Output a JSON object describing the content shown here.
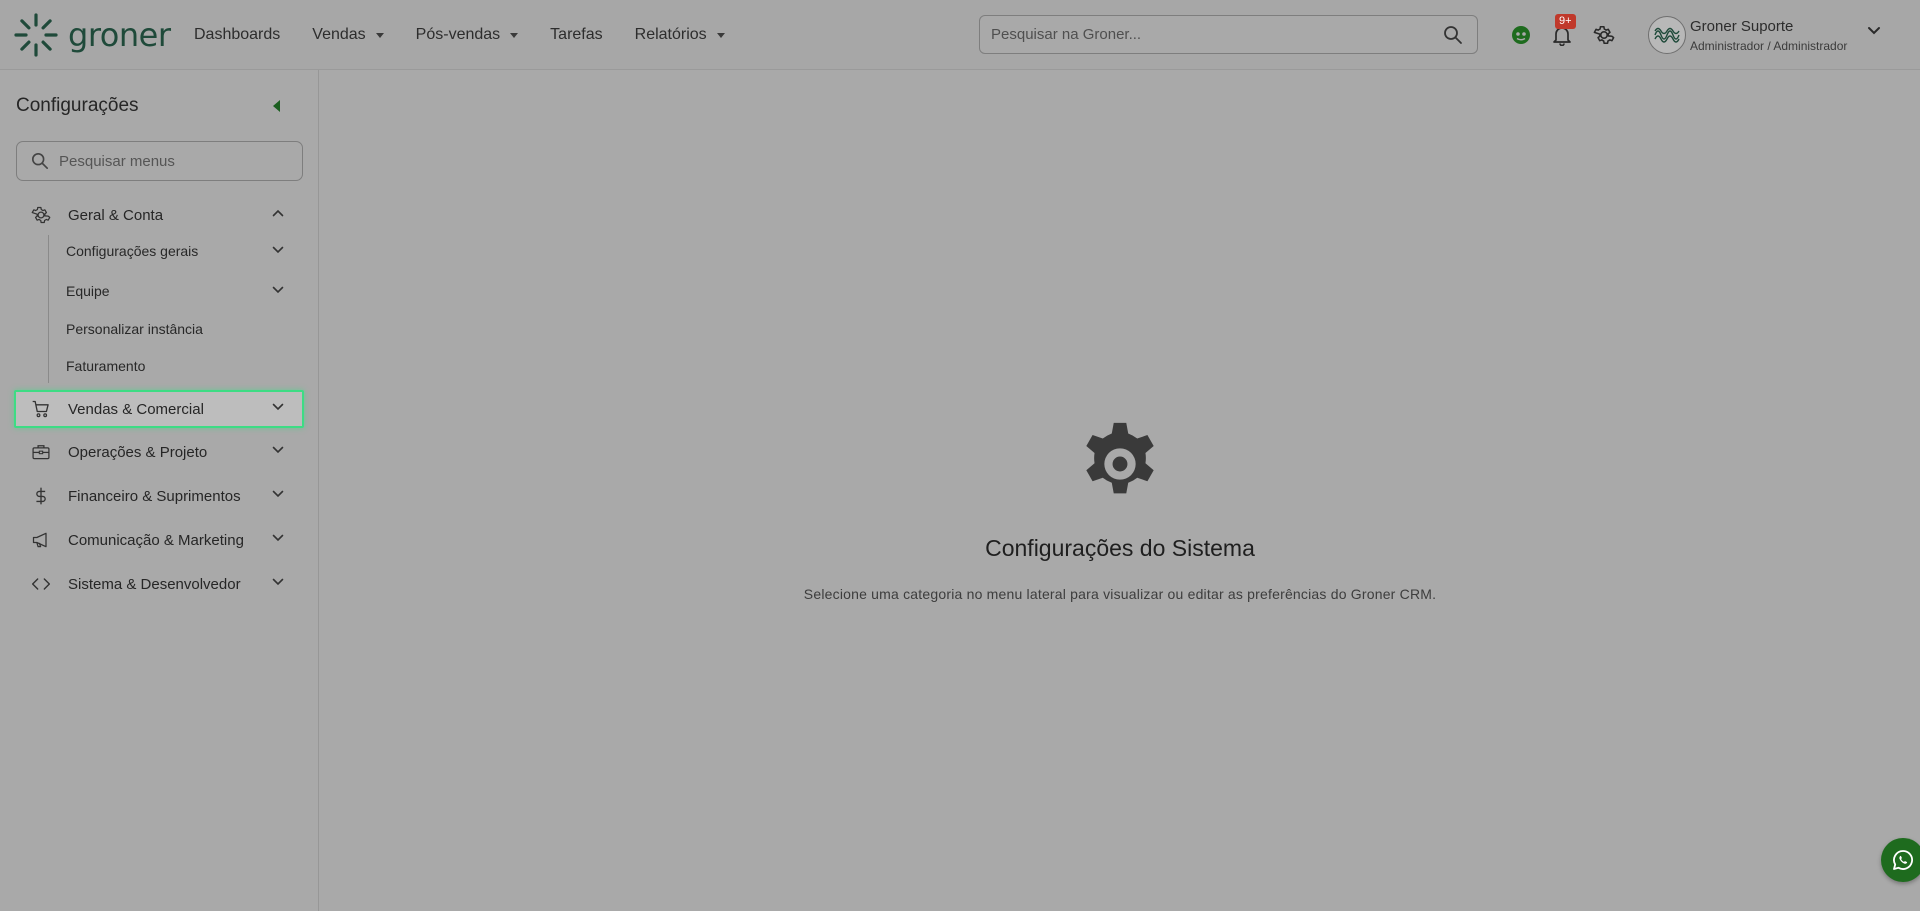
{
  "brand": {
    "name": "groner"
  },
  "topnav": [
    {
      "label": "Dashboards",
      "caret": false
    },
    {
      "label": "Vendas",
      "caret": true
    },
    {
      "label": "Pós-vendas",
      "caret": true
    },
    {
      "label": "Tarefas",
      "caret": false
    },
    {
      "label": "Relatórios",
      "caret": true
    }
  ],
  "search": {
    "placeholder": "Pesquisar na Groner..."
  },
  "notifications": {
    "badge": "9+"
  },
  "user": {
    "name": "Groner Suporte",
    "role": "Administrador / Administrador"
  },
  "sidebar": {
    "title": "Configurações",
    "search_placeholder": "Pesquisar menus",
    "groups": [
      {
        "label": "Geral & Conta",
        "icon": "gear-icon",
        "expanded": true
      },
      {
        "label": "Vendas & Comercial",
        "icon": "cart-icon",
        "active": true
      },
      {
        "label": "Operações & Projeto",
        "icon": "toolbox-icon"
      },
      {
        "label": "Financeiro & Suprimentos",
        "icon": "dollar-icon"
      },
      {
        "label": "Comunicação & Marketing",
        "icon": "megaphone-icon"
      },
      {
        "label": "Sistema & Desenvolvedor",
        "icon": "code-icon"
      }
    ],
    "subitems": [
      {
        "label": "Configurações gerais",
        "has_children": true
      },
      {
        "label": "Equipe",
        "has_children": true
      },
      {
        "label": "Personalizar instância",
        "has_children": false
      },
      {
        "label": "Faturamento",
        "has_children": false
      }
    ]
  },
  "main": {
    "title": "Configurações do Sistema",
    "subtitle": "Selecione uma categoria no menu lateral para visualizar ou editar as preferências do Groner CRM."
  },
  "colors": {
    "accent": "#1e6b1e",
    "active_border": "#3ddc84",
    "badge": "#c0392b"
  }
}
